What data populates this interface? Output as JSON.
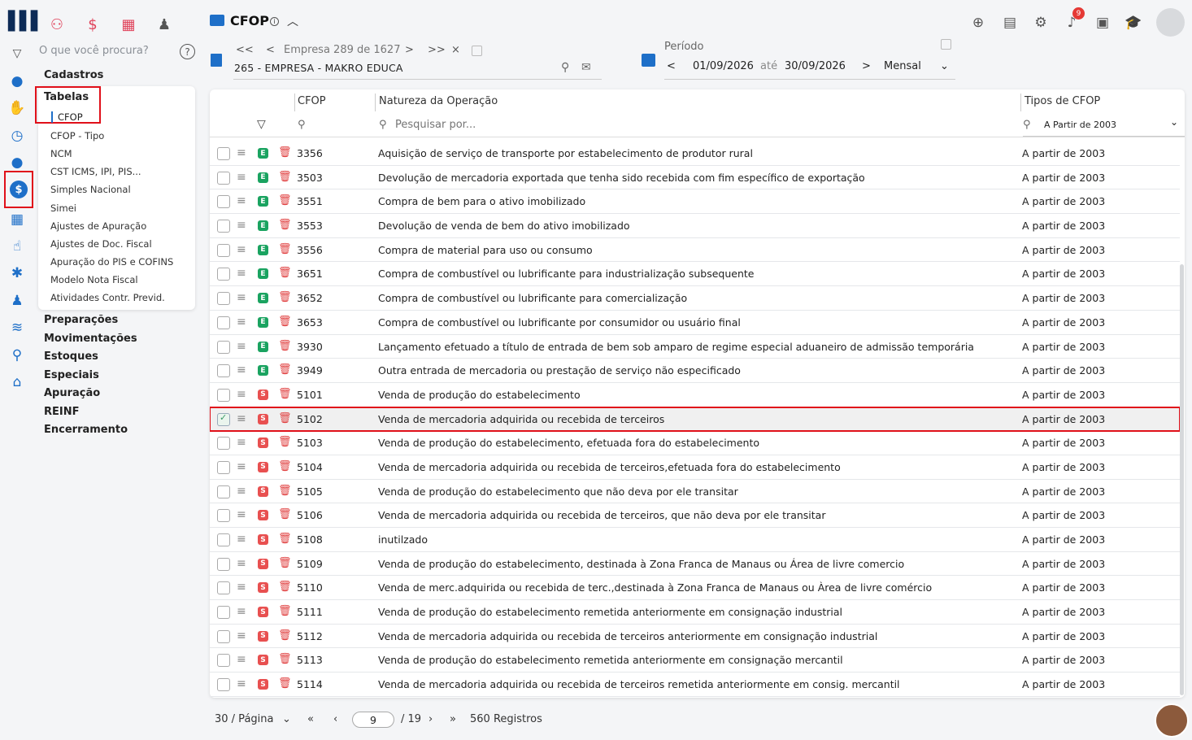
{
  "header": {
    "title": "CFOP",
    "info_icon": "i",
    "collapse_icon": "chevron-up-icon",
    "notification_count": "9"
  },
  "sidebar": {
    "search_placeholder": "O que você procura?",
    "help_label": "?",
    "cadastros": "Cadastros",
    "tabelas": "Tabelas",
    "active_item": "CFOP",
    "items": [
      "CFOP - Tipo",
      "NCM",
      "CST ICMS, IPI, PIS...",
      "Simples Nacional",
      "Simei",
      "Ajustes de Apuração",
      "Ajustes de Doc. Fiscal",
      "Apuração do PIS e COFINS",
      "Modelo Nota Fiscal",
      "Atividades Contr. Previd."
    ],
    "sections": [
      "Preparações",
      "Movimentações",
      "Estoques",
      "Especiais",
      "Apuração",
      "REINF",
      "Encerramento"
    ]
  },
  "empresa": {
    "counter": "Empresa 289 de 1627",
    "name": "265 - EMPRESA - MAKRO EDUCA",
    "first": "<<",
    "prev": "<",
    "next": ">",
    "last": ">>",
    "close": "×"
  },
  "periodo": {
    "label": "Período",
    "start": "01/09/2026",
    "ate": "até",
    "end": "30/09/2026",
    "mode": "Mensal"
  },
  "table": {
    "columns": {
      "cfop": "CFOP",
      "natureza": "Natureza da Operação",
      "tipos": "Tipos de CFOP"
    },
    "search_placeholder": "Pesquisar por...",
    "tipo_filter": "A Partir de 2003",
    "rows": [
      {
        "type": "E",
        "code": "3356",
        "desc": "Aquisição de serviço de transporte por estabelecimento de produtor rural",
        "tipo": "A partir de 2003"
      },
      {
        "type": "E",
        "code": "3503",
        "desc": "Devolução de mercadoria exportada que tenha sido recebida com fim específico de exportação",
        "tipo": "A partir de 2003"
      },
      {
        "type": "E",
        "code": "3551",
        "desc": "Compra de bem para o ativo imobilizado",
        "tipo": "A partir de 2003"
      },
      {
        "type": "E",
        "code": "3553",
        "desc": "Devolução de venda de bem do ativo imobilizado",
        "tipo": "A partir de 2003"
      },
      {
        "type": "E",
        "code": "3556",
        "desc": "Compra de material para uso ou consumo",
        "tipo": "A partir de 2003"
      },
      {
        "type": "E",
        "code": "3651",
        "desc": "Compra de combustível ou lubrificante para industrialização subsequente",
        "tipo": "A partir de 2003"
      },
      {
        "type": "E",
        "code": "3652",
        "desc": "Compra de combustível ou lubrificante para comercialização",
        "tipo": "A partir de 2003"
      },
      {
        "type": "E",
        "code": "3653",
        "desc": "Compra de combustível ou lubrificante por consumidor ou usuário final",
        "tipo": "A partir de 2003"
      },
      {
        "type": "E",
        "code": "3930",
        "desc": "Lançamento efetuado a título de entrada de bem sob amparo de regime especial aduaneiro de admissão temporária",
        "tipo": "A partir de 2003"
      },
      {
        "type": "E",
        "code": "3949",
        "desc": "Outra entrada de mercadoria ou prestação de serviço não especificado",
        "tipo": "A partir de 2003"
      },
      {
        "type": "S",
        "code": "5101",
        "desc": "Venda de produção do estabelecimento",
        "tipo": "A partir de 2003"
      },
      {
        "type": "S",
        "code": "5102",
        "desc": "Venda de mercadoria adquirida ou recebida de terceiros",
        "tipo": "A partir de 2003",
        "selected": true
      },
      {
        "type": "S",
        "code": "5103",
        "desc": "Venda de produção do estabelecimento, efetuada fora do estabelecimento",
        "tipo": "A partir de 2003"
      },
      {
        "type": "S",
        "code": "5104",
        "desc": "Venda de mercadoria adquirida ou recebida de terceiros,efetuada fora do estabelecimento",
        "tipo": "A partir de 2003"
      },
      {
        "type": "S",
        "code": "5105",
        "desc": "Venda de produção do estabelecimento que não deva por ele transitar",
        "tipo": "A partir de 2003"
      },
      {
        "type": "S",
        "code": "5106",
        "desc": "Venda de mercadoria adquirida ou recebida de terceiros, que não deva por ele transitar",
        "tipo": "A partir de 2003"
      },
      {
        "type": "S",
        "code": "5108",
        "desc": "inutilzado",
        "tipo": "A partir de 2003"
      },
      {
        "type": "S",
        "code": "5109",
        "desc": "Venda de produção do estabelecimento, destinada à Zona Franca de Manaus ou Área de livre comercio",
        "tipo": "A partir de 2003"
      },
      {
        "type": "S",
        "code": "5110",
        "desc": "Venda de merc.adquirida ou recebida de terc.,destinada à Zona Franca de Manaus ou Àrea de livre comércio",
        "tipo": "A partir de 2003"
      },
      {
        "type": "S",
        "code": "5111",
        "desc": "Venda de produção do estabelecimento remetida anteriormente em consignação industrial",
        "tipo": "A partir de 2003"
      },
      {
        "type": "S",
        "code": "5112",
        "desc": "Venda de mercadoria adquirida ou recebida de terceiros anteriormente em consignação industrial",
        "tipo": "A partir de 2003"
      },
      {
        "type": "S",
        "code": "5113",
        "desc": "Venda de produção do estabelecimento remetida anteriormente em consignação mercantil",
        "tipo": "A partir de 2003"
      },
      {
        "type": "S",
        "code": "5114",
        "desc": "Venda de mercadoria adquirida ou recebida de terceiros remetida anteriormente em consig. mercantil",
        "tipo": "A partir de 2003"
      }
    ]
  },
  "pagination": {
    "per_page": "30 / Página",
    "page": "9",
    "total_pages": "/ 19",
    "records": "560 Registros"
  },
  "colors": {
    "accent": "#1e6fc8",
    "highlight": "#e0101a",
    "entrada": "#1aa360",
    "saida": "#e85050"
  }
}
